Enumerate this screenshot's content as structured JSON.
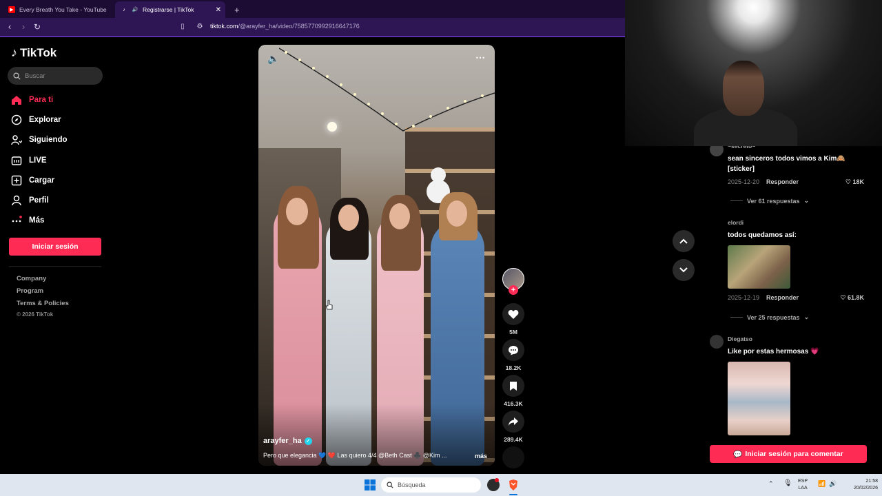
{
  "browser": {
    "tabs": [
      {
        "label": "Every Breath You Take - YouTube",
        "active": false
      },
      {
        "label": "Registrarse | TikTok",
        "active": true
      }
    ],
    "url_host": "tiktok.com",
    "url_path": "/@arayfer_ha/video/7585770992916647176"
  },
  "sidebar": {
    "logo": "TikTok",
    "search_placeholder": "Buscar",
    "items": [
      {
        "label": "Para ti",
        "icon": "home-icon"
      },
      {
        "label": "Explorar",
        "icon": "compass-icon"
      },
      {
        "label": "Siguiendo",
        "icon": "following-icon"
      },
      {
        "label": "LIVE",
        "icon": "live-icon"
      },
      {
        "label": "Cargar",
        "icon": "upload-icon"
      },
      {
        "label": "Perfil",
        "icon": "profile-icon"
      },
      {
        "label": "Más",
        "icon": "more-icon"
      }
    ],
    "login_label": "Iniciar sesión",
    "footer_links": [
      "Company",
      "Program",
      "Terms & Policies"
    ],
    "copyright": "© 2026 TikTok"
  },
  "video": {
    "username": "arayfer_ha",
    "caption": "Pero que elegancia 💙 ❤️ Las quiero 4/4 @Beth Cast ♣️ @Kim ...",
    "more_label": "más"
  },
  "actions": {
    "likes": "5M",
    "comments": "18.2K",
    "saves": "416.3K",
    "shares": "289.4K"
  },
  "comments": [
    {
      "user": "~secreto~",
      "text": "sean sinceros todos vimos a Kim🙈 [sticker]",
      "date": "2025-12-20",
      "reply_label": "Responder",
      "likes": "18K",
      "replies": "Ver 61 respuestas"
    },
    {
      "user": "elordi",
      "text": "todos quedamos así:",
      "date": "2025-12-19",
      "reply_label": "Responder",
      "likes": "61.8K",
      "replies": "Ver 25 respuestas"
    },
    {
      "user": "Diegatso",
      "text": "Like por estas hermosas 💗"
    }
  ],
  "comment_login_label": "Iniciar sesión para comentar",
  "taskbar": {
    "search_label": "Búsqueda",
    "lang_top": "ESP",
    "lang_bottom": "LAA",
    "time": "21:58",
    "date": "20/02/2026"
  },
  "colors": {
    "accent": "#fe2c55",
    "browser": "#2e1654",
    "verified": "#20d5ec"
  }
}
